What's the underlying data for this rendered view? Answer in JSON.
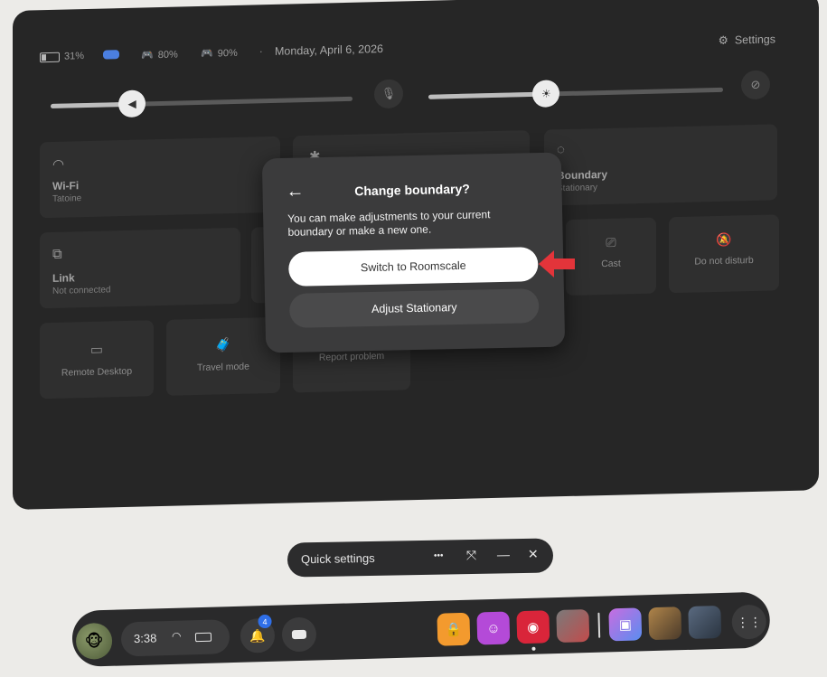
{
  "status": {
    "battery": "31%",
    "controller_left": "80%",
    "controller_right": "90%",
    "separator": "·",
    "date": "Monday, April 6, 2026",
    "settings_label": "Settings"
  },
  "sliders": {
    "volume_level": 0.27,
    "brightness_level": 0.4
  },
  "tiles": {
    "wifi": {
      "title": "Wi-Fi",
      "subtitle": "Tatoine"
    },
    "boundary": {
      "title": "Boundary",
      "subtitle": "Stationary"
    },
    "link": {
      "title": "Link",
      "subtitle": "Not connected"
    },
    "cast": {
      "label": "Cast"
    },
    "dnd": {
      "label": "Do not disturb"
    },
    "remote": {
      "label": "Remote Desktop"
    },
    "travel": {
      "label": "Travel mode"
    },
    "report": {
      "label": "Report problem"
    }
  },
  "dialog": {
    "title": "Change boundary?",
    "description": "You can make adjustments to your current boundary or make a new one.",
    "primary_button": "Switch to Roomscale",
    "secondary_button": "Adjust Stationary"
  },
  "quick_settings_bar": {
    "label": "Quick settings",
    "more": "•••",
    "expand": "⤧",
    "minimize": "—",
    "close": "✕"
  },
  "taskbar": {
    "time": "3:38",
    "notification_count": "4"
  },
  "colors": {
    "accent": "#4b7fe0",
    "badge": "#2f6fe8",
    "arrow": "#e3343a"
  }
}
